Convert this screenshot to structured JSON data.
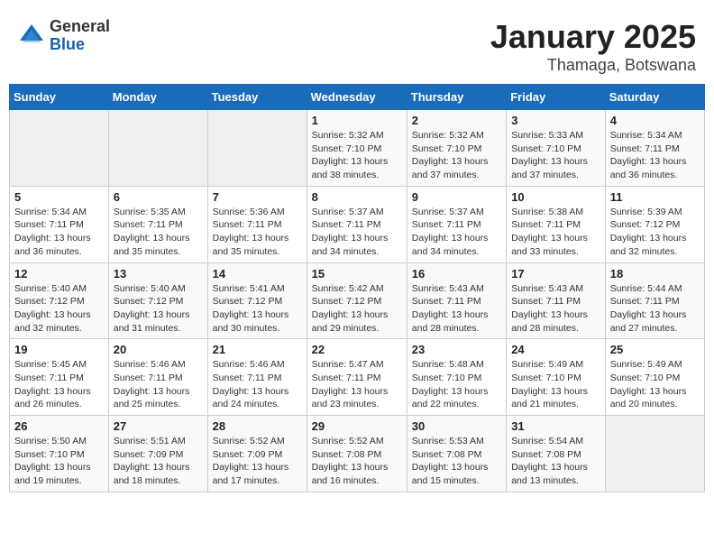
{
  "logo": {
    "general": "General",
    "blue": "Blue"
  },
  "title": {
    "month": "January 2025",
    "location": "Thamaga, Botswana"
  },
  "weekdays": [
    "Sunday",
    "Monday",
    "Tuesday",
    "Wednesday",
    "Thursday",
    "Friday",
    "Saturday"
  ],
  "weeks": [
    [
      {
        "day": "",
        "info": ""
      },
      {
        "day": "",
        "info": ""
      },
      {
        "day": "",
        "info": ""
      },
      {
        "day": "1",
        "info": "Sunrise: 5:32 AM\nSunset: 7:10 PM\nDaylight: 13 hours\nand 38 minutes."
      },
      {
        "day": "2",
        "info": "Sunrise: 5:32 AM\nSunset: 7:10 PM\nDaylight: 13 hours\nand 37 minutes."
      },
      {
        "day": "3",
        "info": "Sunrise: 5:33 AM\nSunset: 7:10 PM\nDaylight: 13 hours\nand 37 minutes."
      },
      {
        "day": "4",
        "info": "Sunrise: 5:34 AM\nSunset: 7:11 PM\nDaylight: 13 hours\nand 36 minutes."
      }
    ],
    [
      {
        "day": "5",
        "info": "Sunrise: 5:34 AM\nSunset: 7:11 PM\nDaylight: 13 hours\nand 36 minutes."
      },
      {
        "day": "6",
        "info": "Sunrise: 5:35 AM\nSunset: 7:11 PM\nDaylight: 13 hours\nand 35 minutes."
      },
      {
        "day": "7",
        "info": "Sunrise: 5:36 AM\nSunset: 7:11 PM\nDaylight: 13 hours\nand 35 minutes."
      },
      {
        "day": "8",
        "info": "Sunrise: 5:37 AM\nSunset: 7:11 PM\nDaylight: 13 hours\nand 34 minutes."
      },
      {
        "day": "9",
        "info": "Sunrise: 5:37 AM\nSunset: 7:11 PM\nDaylight: 13 hours\nand 34 minutes."
      },
      {
        "day": "10",
        "info": "Sunrise: 5:38 AM\nSunset: 7:11 PM\nDaylight: 13 hours\nand 33 minutes."
      },
      {
        "day": "11",
        "info": "Sunrise: 5:39 AM\nSunset: 7:12 PM\nDaylight: 13 hours\nand 32 minutes."
      }
    ],
    [
      {
        "day": "12",
        "info": "Sunrise: 5:40 AM\nSunset: 7:12 PM\nDaylight: 13 hours\nand 32 minutes."
      },
      {
        "day": "13",
        "info": "Sunrise: 5:40 AM\nSunset: 7:12 PM\nDaylight: 13 hours\nand 31 minutes."
      },
      {
        "day": "14",
        "info": "Sunrise: 5:41 AM\nSunset: 7:12 PM\nDaylight: 13 hours\nand 30 minutes."
      },
      {
        "day": "15",
        "info": "Sunrise: 5:42 AM\nSunset: 7:12 PM\nDaylight: 13 hours\nand 29 minutes."
      },
      {
        "day": "16",
        "info": "Sunrise: 5:43 AM\nSunset: 7:11 PM\nDaylight: 13 hours\nand 28 minutes."
      },
      {
        "day": "17",
        "info": "Sunrise: 5:43 AM\nSunset: 7:11 PM\nDaylight: 13 hours\nand 28 minutes."
      },
      {
        "day": "18",
        "info": "Sunrise: 5:44 AM\nSunset: 7:11 PM\nDaylight: 13 hours\nand 27 minutes."
      }
    ],
    [
      {
        "day": "19",
        "info": "Sunrise: 5:45 AM\nSunset: 7:11 PM\nDaylight: 13 hours\nand 26 minutes."
      },
      {
        "day": "20",
        "info": "Sunrise: 5:46 AM\nSunset: 7:11 PM\nDaylight: 13 hours\nand 25 minutes."
      },
      {
        "day": "21",
        "info": "Sunrise: 5:46 AM\nSunset: 7:11 PM\nDaylight: 13 hours\nand 24 minutes."
      },
      {
        "day": "22",
        "info": "Sunrise: 5:47 AM\nSunset: 7:11 PM\nDaylight: 13 hours\nand 23 minutes."
      },
      {
        "day": "23",
        "info": "Sunrise: 5:48 AM\nSunset: 7:10 PM\nDaylight: 13 hours\nand 22 minutes."
      },
      {
        "day": "24",
        "info": "Sunrise: 5:49 AM\nSunset: 7:10 PM\nDaylight: 13 hours\nand 21 minutes."
      },
      {
        "day": "25",
        "info": "Sunrise: 5:49 AM\nSunset: 7:10 PM\nDaylight: 13 hours\nand 20 minutes."
      }
    ],
    [
      {
        "day": "26",
        "info": "Sunrise: 5:50 AM\nSunset: 7:10 PM\nDaylight: 13 hours\nand 19 minutes."
      },
      {
        "day": "27",
        "info": "Sunrise: 5:51 AM\nSunset: 7:09 PM\nDaylight: 13 hours\nand 18 minutes."
      },
      {
        "day": "28",
        "info": "Sunrise: 5:52 AM\nSunset: 7:09 PM\nDaylight: 13 hours\nand 17 minutes."
      },
      {
        "day": "29",
        "info": "Sunrise: 5:52 AM\nSunset: 7:08 PM\nDaylight: 13 hours\nand 16 minutes."
      },
      {
        "day": "30",
        "info": "Sunrise: 5:53 AM\nSunset: 7:08 PM\nDaylight: 13 hours\nand 15 minutes."
      },
      {
        "day": "31",
        "info": "Sunrise: 5:54 AM\nSunset: 7:08 PM\nDaylight: 13 hours\nand 13 minutes."
      },
      {
        "day": "",
        "info": ""
      }
    ]
  ]
}
